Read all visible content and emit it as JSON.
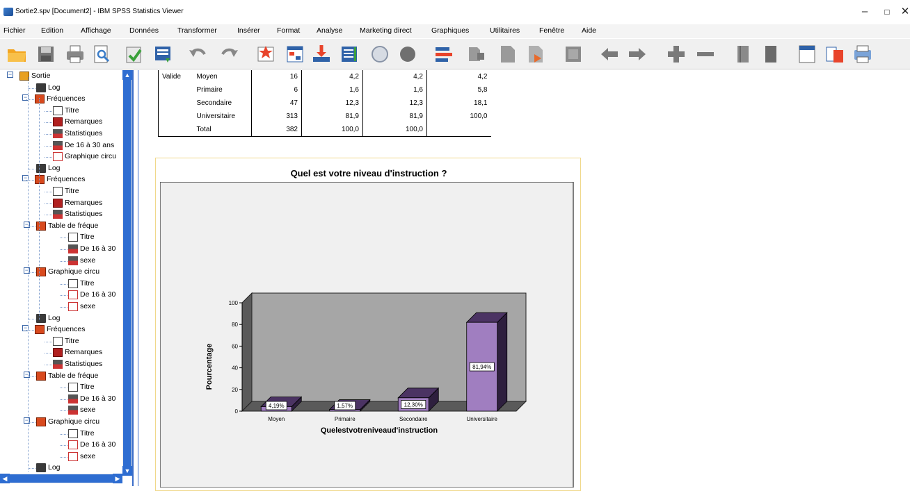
{
  "window": {
    "title": "Sortie2.spv [Document2] - IBM SPSS Statistics Viewer",
    "minimize": "–",
    "maximize": "□",
    "close": "✕"
  },
  "menu": [
    "Fichier",
    "Edition",
    "Affichage",
    "Données",
    "Transformer",
    "Insérer",
    "Format",
    "Analyse",
    "Marketing direct",
    "Graphiques",
    "Utilitaires",
    "Fenêtre",
    "Aide"
  ],
  "toolbar": {
    "icons": [
      "open-folder-icon",
      "save-icon",
      "print-icon",
      "print-preview-icon",
      "export-icon",
      "recall-dialog-icon",
      "undo-icon",
      "redo-icon",
      "goto-data-icon",
      "goto-case-icon",
      "goto-variable-icon",
      "variables-icon",
      "designate-window-icon",
      "show-all-icon",
      "promote-icon",
      "demote-icon",
      "insert-heading-icon",
      "insert-title-icon",
      "insert-text-icon",
      "insert-chart-icon",
      "back-icon",
      "forward-icon",
      "expand-icon",
      "collapse-icon",
      "show-icon",
      "hide-icon",
      "insert-page-icon",
      "insert-output-icon",
      "pivot-icon"
    ]
  },
  "outline": {
    "items": [
      {
        "label": "Sortie",
        "icon": "book-icon"
      },
      {
        "label": "Log",
        "icon": "log-icon"
      },
      {
        "label": "Fréquences",
        "icon": "procedure-icon"
      },
      {
        "label": "Titre",
        "icon": "title-icon"
      },
      {
        "label": "Remarques",
        "icon": "notes-icon"
      },
      {
        "label": "Statistiques",
        "icon": "table-icon"
      },
      {
        "label": "De 16 à 30 ans",
        "icon": "table-icon"
      },
      {
        "label": "Graphique circu",
        "icon": "chart-icon"
      },
      {
        "label": "Log",
        "icon": "log-icon"
      },
      {
        "label": "Fréquences",
        "icon": "procedure-icon"
      },
      {
        "label": "Titre",
        "icon": "title-icon"
      },
      {
        "label": "Remarques",
        "icon": "notes-icon"
      },
      {
        "label": "Statistiques",
        "icon": "table-icon"
      },
      {
        "label": "Table de fréque",
        "icon": "procedure-icon"
      },
      {
        "label": "Titre",
        "icon": "title-icon"
      },
      {
        "label": "De 16 à 30",
        "icon": "table-icon"
      },
      {
        "label": "sexe",
        "icon": "table-icon"
      },
      {
        "label": "Graphique circu",
        "icon": "procedure-icon"
      },
      {
        "label": "Titre",
        "icon": "title-icon"
      },
      {
        "label": "De 16 à 30",
        "icon": "chart-icon"
      },
      {
        "label": "sexe",
        "icon": "chart-icon"
      },
      {
        "label": "Log",
        "icon": "log-icon"
      },
      {
        "label": "Fréquences",
        "icon": "procedure-icon"
      },
      {
        "label": "Titre",
        "icon": "title-icon"
      },
      {
        "label": "Remarques",
        "icon": "notes-icon"
      },
      {
        "label": "Statistiques",
        "icon": "table-icon"
      },
      {
        "label": "Table de fréque",
        "icon": "procedure-icon"
      },
      {
        "label": "Titre",
        "icon": "title-icon"
      },
      {
        "label": "De 16 à 30",
        "icon": "table-icon"
      },
      {
        "label": "sexe",
        "icon": "table-icon"
      },
      {
        "label": "Graphique circu",
        "icon": "procedure-icon"
      },
      {
        "label": "Titre",
        "icon": "title-icon"
      },
      {
        "label": "De 16 à 30",
        "icon": "chart-icon"
      },
      {
        "label": "sexe",
        "icon": "chart-icon"
      },
      {
        "label": "Log",
        "icon": "log-icon"
      }
    ]
  },
  "freq_table": {
    "group_label": "Valide",
    "rows": [
      {
        "label": "Moyen",
        "freq": "16",
        "pct": "4,2",
        "valid_pct": "4,2",
        "cum_pct": "4,2"
      },
      {
        "label": "Primaire",
        "freq": "6",
        "pct": "1,6",
        "valid_pct": "1,6",
        "cum_pct": "5,8"
      },
      {
        "label": "Secondaire",
        "freq": "47",
        "pct": "12,3",
        "valid_pct": "12,3",
        "cum_pct": "18,1"
      },
      {
        "label": "Universitaire",
        "freq": "313",
        "pct": "81,9",
        "valid_pct": "81,9",
        "cum_pct": "100,0"
      },
      {
        "label": "Total",
        "freq": "382",
        "pct": "100,0",
        "valid_pct": "100,0",
        "cum_pct": ""
      }
    ]
  },
  "chart_data": {
    "type": "bar",
    "title": "Quel est votre niveau d'instruction ?",
    "xlabel": "Quelestvotreniveaud'instruction",
    "ylabel": "Pourcentage",
    "categories": [
      "Moyen",
      "Primaire",
      "Secondaire",
      "Universitaire"
    ],
    "values": [
      4.19,
      1.57,
      12.3,
      81.94
    ],
    "data_labels": [
      "4,19%",
      "1,57%",
      "12,30%",
      "81,94%"
    ],
    "yticks": [
      "0",
      "20",
      "40",
      "60",
      "80",
      "100"
    ],
    "ylim": [
      0,
      100
    ],
    "grid": false,
    "colors": {
      "bar_front": "#a07ec0",
      "bar_side": "#2e1f3e",
      "bar_top": "#4b3363",
      "plot_wall": "#a6a6a6",
      "plot_floor": "#5a5a5a",
      "outer_bg": "#f0f0f0"
    }
  }
}
